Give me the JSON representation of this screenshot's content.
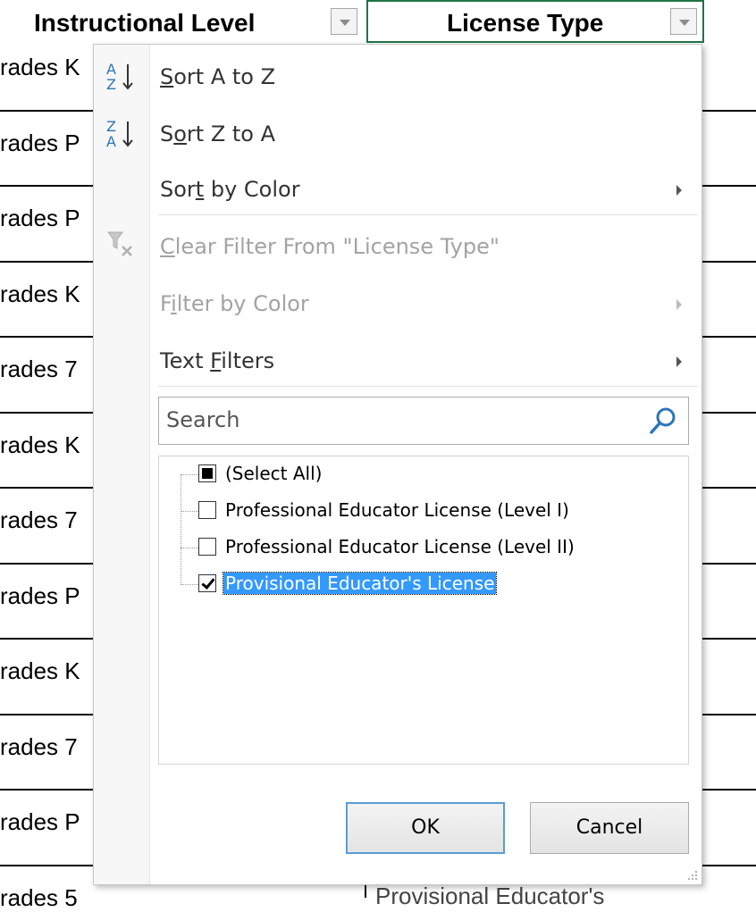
{
  "header": {
    "col1_title": "Instructional Level",
    "col2_title": "License Type"
  },
  "cells": [
    "rades K",
    "rades P",
    "rades P",
    "rades K",
    "rades 7",
    "rades K",
    "rades 7",
    "rades P",
    "rades K",
    "rades 7",
    "rades P",
    "rades 5"
  ],
  "bottom_cell": "Provisional Educator's",
  "menu": {
    "sort_a_z": {
      "pre": "",
      "ul": "S",
      "post": "ort A to Z"
    },
    "sort_z_a": {
      "pre": "S",
      "ul": "o",
      "post": "rt Z to A"
    },
    "sort_by_color": {
      "pre": "Sor",
      "ul": "t",
      "post": " by Color"
    },
    "clear_filter": {
      "pre": "",
      "ul": "C",
      "post": "lear Filter From \"License Type\""
    },
    "filter_by_color": {
      "pre": "F",
      "ul": "i",
      "post": "lter by Color"
    },
    "text_filters": {
      "pre": "Text ",
      "ul": "F",
      "post": "ilters"
    },
    "search_placeholder": "Search",
    "items": [
      {
        "label": "(Select All)",
        "state": "mixed"
      },
      {
        "label": "Professional Educator License (Level I)",
        "state": "off"
      },
      {
        "label": "Professional Educator License (Level II)",
        "state": "off"
      },
      {
        "label": "Provisional Educator's License",
        "state": "on"
      }
    ],
    "ok_label": "OK",
    "cancel_label": "Cancel"
  }
}
